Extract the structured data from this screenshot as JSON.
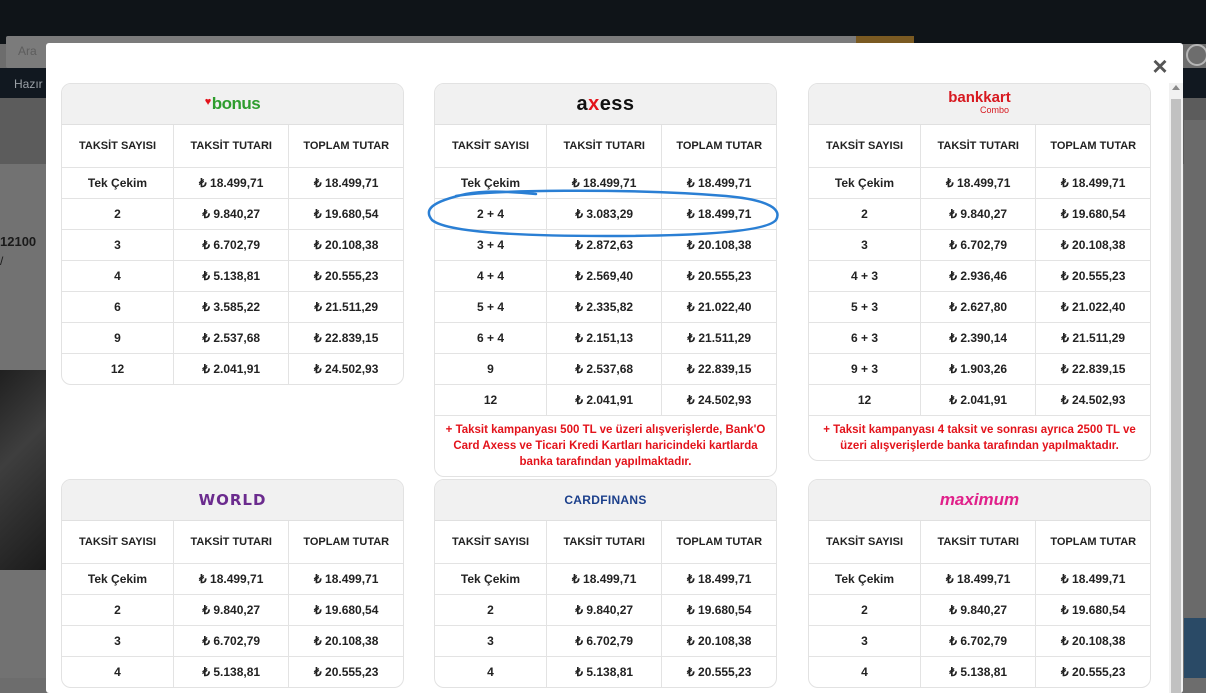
{
  "background": {
    "search_placeholder": "Ara",
    "nav_text": "Hazır",
    "model_text": "12100",
    "model_sub": "/"
  },
  "modal": {
    "close_label": "×"
  },
  "columns": [
    "TAKSİT SAYISI",
    "TAKSİT TUTARI",
    "TOPLAM TUTAR"
  ],
  "cards": {
    "bonus": {
      "logo": "bonus",
      "rows": [
        [
          "Tek Çekim",
          "₺ 18.499,71",
          "₺ 18.499,71"
        ],
        [
          "2",
          "₺ 9.840,27",
          "₺ 19.680,54"
        ],
        [
          "3",
          "₺ 6.702,79",
          "₺ 20.108,38"
        ],
        [
          "4",
          "₺ 5.138,81",
          "₺ 20.555,23"
        ],
        [
          "6",
          "₺ 3.585,22",
          "₺ 21.511,29"
        ],
        [
          "9",
          "₺ 2.537,68",
          "₺ 22.839,15"
        ],
        [
          "12",
          "₺ 2.041,91",
          "₺ 24.502,93"
        ]
      ]
    },
    "axess": {
      "logo_a": "a",
      "logo_x": "x",
      "logo_rest": "ess",
      "rows": [
        [
          "Tek Çekim",
          "₺ 18.499,71",
          "₺ 18.499,71"
        ],
        [
          "2 + 4",
          "₺ 3.083,29",
          "₺ 18.499,71"
        ],
        [
          "3 + 4",
          "₺ 2.872,63",
          "₺ 20.108,38"
        ],
        [
          "4 + 4",
          "₺ 2.569,40",
          "₺ 20.555,23"
        ],
        [
          "5 + 4",
          "₺ 2.335,82",
          "₺ 21.022,40"
        ],
        [
          "6 + 4",
          "₺ 2.151,13",
          "₺ 21.511,29"
        ],
        [
          "9",
          "₺ 2.537,68",
          "₺ 22.839,15"
        ],
        [
          "12",
          "₺ 2.041,91",
          "₺ 24.502,93"
        ]
      ],
      "note": "+ Taksit kampanyası 500 TL ve üzeri alışverişlerde, Bank'O Card Axess ve Ticari Kredi Kartları haricindeki kartlarda banka tarafından yapılmaktadır."
    },
    "bankkart": {
      "logo_main": "bankkart",
      "logo_sub": "Combo",
      "rows": [
        [
          "Tek Çekim",
          "₺ 18.499,71",
          "₺ 18.499,71"
        ],
        [
          "2",
          "₺ 9.840,27",
          "₺ 19.680,54"
        ],
        [
          "3",
          "₺ 6.702,79",
          "₺ 20.108,38"
        ],
        [
          "4 + 3",
          "₺ 2.936,46",
          "₺ 20.555,23"
        ],
        [
          "5 + 3",
          "₺ 2.627,80",
          "₺ 21.022,40"
        ],
        [
          "6 + 3",
          "₺ 2.390,14",
          "₺ 21.511,29"
        ],
        [
          "9 + 3",
          "₺ 1.903,26",
          "₺ 22.839,15"
        ],
        [
          "12",
          "₺ 2.041,91",
          "₺ 24.502,93"
        ]
      ],
      "note": "+ Taksit kampanyası 4 taksit ve sonrası ayrıca 2500 TL ve üzeri alışverişlerde banka tarafından yapılmaktadır."
    },
    "world": {
      "logo": "WORLD",
      "rows": [
        [
          "Tek Çekim",
          "₺ 18.499,71",
          "₺ 18.499,71"
        ],
        [
          "2",
          "₺ 9.840,27",
          "₺ 19.680,54"
        ],
        [
          "3",
          "₺ 6.702,79",
          "₺ 20.108,38"
        ],
        [
          "4",
          "₺ 5.138,81",
          "₺ 20.555,23"
        ]
      ]
    },
    "cardfinans": {
      "logo": "CARDFINANS",
      "rows": [
        [
          "Tek Çekim",
          "₺ 18.499,71",
          "₺ 18.499,71"
        ],
        [
          "2",
          "₺ 9.840,27",
          "₺ 19.680,54"
        ],
        [
          "3",
          "₺ 6.702,79",
          "₺ 20.108,38"
        ],
        [
          "4",
          "₺ 5.138,81",
          "₺ 20.555,23"
        ]
      ]
    },
    "maximum": {
      "logo": "maximum",
      "rows": [
        [
          "Tek Çekim",
          "₺ 18.499,71",
          "₺ 18.499,71"
        ],
        [
          "2",
          "₺ 9.840,27",
          "₺ 19.680,54"
        ],
        [
          "3",
          "₺ 6.702,79",
          "₺ 20.108,38"
        ],
        [
          "4",
          "₺ 5.138,81",
          "₺ 20.555,23"
        ]
      ]
    }
  },
  "colors": {
    "note_red": "#e3131b",
    "annotation_blue": "#2a7fd4",
    "bonus_green": "#2e9d2e",
    "world_purple": "#6b2b8e",
    "maximum_pink": "#e0218a"
  }
}
